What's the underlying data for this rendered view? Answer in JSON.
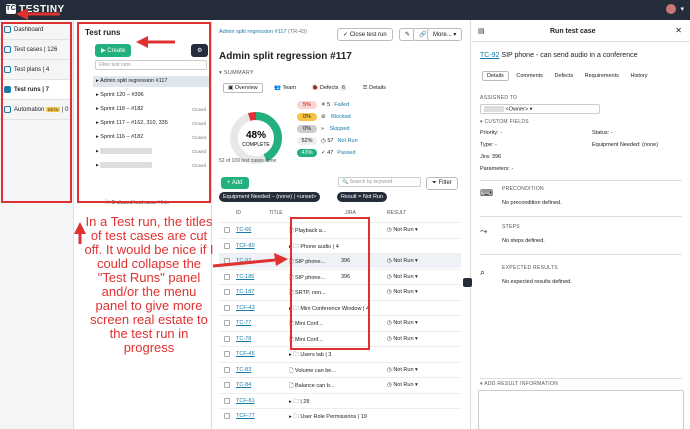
{
  "app": {
    "name": "TESTINY",
    "user_initial": "▾"
  },
  "nav": {
    "items": [
      {
        "label": "Dashboard",
        "count": ""
      },
      {
        "label": "Test cases",
        "count": "126"
      },
      {
        "label": "Test plans",
        "count": "4"
      },
      {
        "label": "Test runs",
        "count": "7"
      },
      {
        "label": "Automation",
        "count": "0"
      }
    ],
    "beta": "BETA"
  },
  "runs_panel": {
    "title": "Test runs",
    "create_label": "Create",
    "filter_placeholder": "Filter test runs",
    "runs": [
      {
        "name": "Admin split regression #117",
        "status": ""
      },
      {
        "name": "Sprint 120 – #396",
        "status": ""
      },
      {
        "name": "Sprint 118 – #182",
        "status": "Closed"
      },
      {
        "name": "Sprint 117 – #162, 310, 335",
        "status": "Closed"
      },
      {
        "name": "Sprint 116 – #182",
        "status": "Closed"
      },
      {
        "name": "",
        "status": "Closed"
      },
      {
        "name": "",
        "status": "Closed"
      }
    ],
    "closed_note": "5 closed test runs.",
    "hide_label": "Hide"
  },
  "main": {
    "breadcrumb": "Admin split regression #117",
    "breadcrumb_id": "(TR-43)",
    "close_run_label": "Close test run",
    "more_label": "More...",
    "title": "Admin split regression #117",
    "summary_label": "SUMMARY",
    "tabs": [
      {
        "label": "Overview"
      },
      {
        "label": "Team"
      },
      {
        "label": "Defects",
        "count": "6"
      },
      {
        "label": "Details"
      }
    ],
    "donut": {
      "percent": "48%",
      "label": "COMPLETE",
      "passed_fraction": 0.43,
      "failed_fraction": 0.05
    },
    "legend": [
      {
        "pct": "5%",
        "count": "5",
        "label": "Failed",
        "color": "#e03131"
      },
      {
        "pct": "0%",
        "count": "",
        "label": "Blocked",
        "color": "#f5c244"
      },
      {
        "pct": "0%",
        "count": "",
        "label": "Skipped",
        "color": "#aaaaaa"
      },
      {
        "pct": "52%",
        "count": "57",
        "label": "Not Run",
        "color": "#e8e8e8"
      },
      {
        "pct": "43%",
        "count": "47",
        "label": "Passed",
        "color": "#22b07d"
      }
    ],
    "done_text": "52 of 109 test cases done",
    "add_label": "Add",
    "search_placeholder": "Search by keyword",
    "filter_label": "Filter",
    "chips": [
      "Equipment Needed – (none) | <unset>",
      "Result = Not Run"
    ],
    "columns": {
      "id": "ID",
      "title": "TITLE",
      "jira": "JIRA",
      "result": "RESULT"
    },
    "rows": [
      {
        "id": "TC-66",
        "title": "Playback a...",
        "jira": "",
        "result": "Not Run"
      },
      {
        "id": "TCF-80",
        "title": "Phone audio | 4",
        "jira": "",
        "result": ""
      },
      {
        "id": "TC-92",
        "title": "SIP phone...",
        "jira": "396",
        "result": "Not Run"
      },
      {
        "id": "TC-186",
        "title": "SIP phone...",
        "jira": "396",
        "result": "Not Run"
      },
      {
        "id": "TC-187",
        "title": "SRTP, non...",
        "jira": "",
        "result": "Not Run"
      },
      {
        "id": "TCF-43",
        "title": "Mini Conference Window | 4",
        "jira": "",
        "result": ""
      },
      {
        "id": "TC-77",
        "title": "Mini Conf...",
        "jira": "",
        "result": "Not Run"
      },
      {
        "id": "TC-78",
        "title": "Mini Conf...",
        "jira": "",
        "result": "Not Run"
      },
      {
        "id": "TCF-45",
        "title": "Users tab | 3",
        "jira": "",
        "result": ""
      },
      {
        "id": "TC-83",
        "title": "Volume can be...",
        "jira": "",
        "result": "Not Run"
      },
      {
        "id": "TC-84",
        "title": "Balance can b...",
        "jira": "",
        "result": "Not Run"
      },
      {
        "id": "TCF-81",
        "title": "| 28",
        "jira": "",
        "result": ""
      },
      {
        "id": "TCF-77",
        "title": "User Role Permissions | 19",
        "jira": "",
        "result": ""
      }
    ]
  },
  "detail": {
    "header": "Run test case",
    "case_id": "TC-92",
    "case_title": "SIP phone - can send audio in a conference",
    "tabs": [
      "Details",
      "Comments",
      "Defects",
      "Requirements",
      "History"
    ],
    "assigned_label": "ASSIGNED TO",
    "assigned_value": "<Owner>",
    "custom_fields_label": "CUSTOM FIELDS",
    "fields": {
      "priority": "Priority: -",
      "status": "Status: -",
      "type": "Type: -",
      "equipment": "Equipment Needed: (none)",
      "jira": "Jira: 396",
      "parameters": "Parameters: -"
    },
    "precondition_label": "PRECONDITION",
    "precondition_value": "No precondition defined.",
    "steps_label": "STEPS",
    "steps_value": "No steps defined.",
    "expected_label": "EXPECTED RESULTS",
    "expected_value": "No expected results defined.",
    "add_result_label": "ADD RESULT INFORMATION"
  },
  "annotation": "In a Test run, the titles of test cases are cut off. It would be nice if I could collapse the \"Test Runs\" panel and/or the menu panel to give more screen real estate to the test run in progress"
}
